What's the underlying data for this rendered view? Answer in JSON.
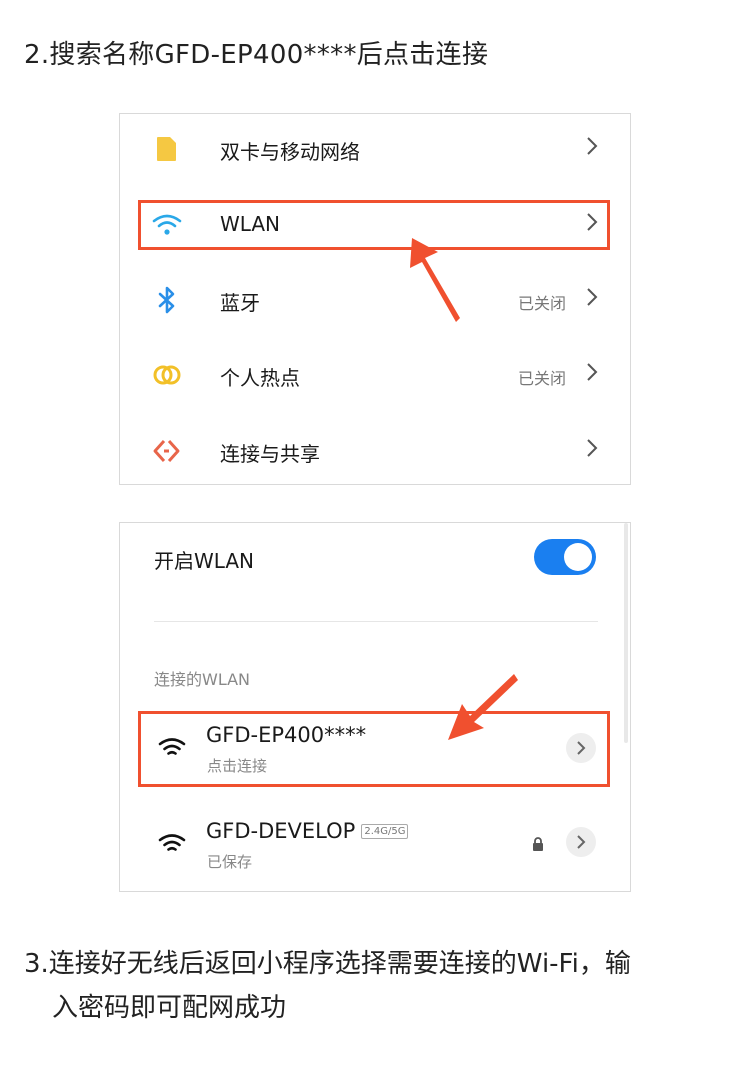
{
  "heading": "2.搜索名称GFD-EP400****后点击连接",
  "settings": {
    "items": [
      {
        "label": "双卡与移动网络",
        "status": "",
        "icon": "sim-card-icon"
      },
      {
        "label": "WLAN",
        "status": "",
        "icon": "wifi-icon"
      },
      {
        "label": "蓝牙",
        "status": "已关闭",
        "icon": "bluetooth-icon"
      },
      {
        "label": "个人热点",
        "status": "已关闭",
        "icon": "hotspot-icon"
      },
      {
        "label": "连接与共享",
        "status": "",
        "icon": "share-icon"
      }
    ]
  },
  "wlan": {
    "toggle_label": "开启WLAN",
    "toggle_on": true,
    "section_label": "连接的WLAN",
    "networks": [
      {
        "ssid": "GFD-EP400****",
        "sub": "点击连接",
        "badge": "",
        "locked": false
      },
      {
        "ssid": "GFD-DEVELOP",
        "sub": "已保存",
        "badge": "2.4G/5G",
        "locked": true
      }
    ]
  },
  "footer": {
    "line1": "3.连接好无线后返回小程序选择需要连接的Wi-Fi，输",
    "line2": "入密码即可配网成功"
  },
  "colors": {
    "highlight": "#f0502f",
    "toggle": "#1a7ff0",
    "wifi_icon": "#2aa8e8",
    "sim_icon": "#f5c842",
    "bluetooth_icon": "#2a8fe8",
    "hotspot_icon": "#f2c028",
    "share_icon": "#e8654a"
  }
}
